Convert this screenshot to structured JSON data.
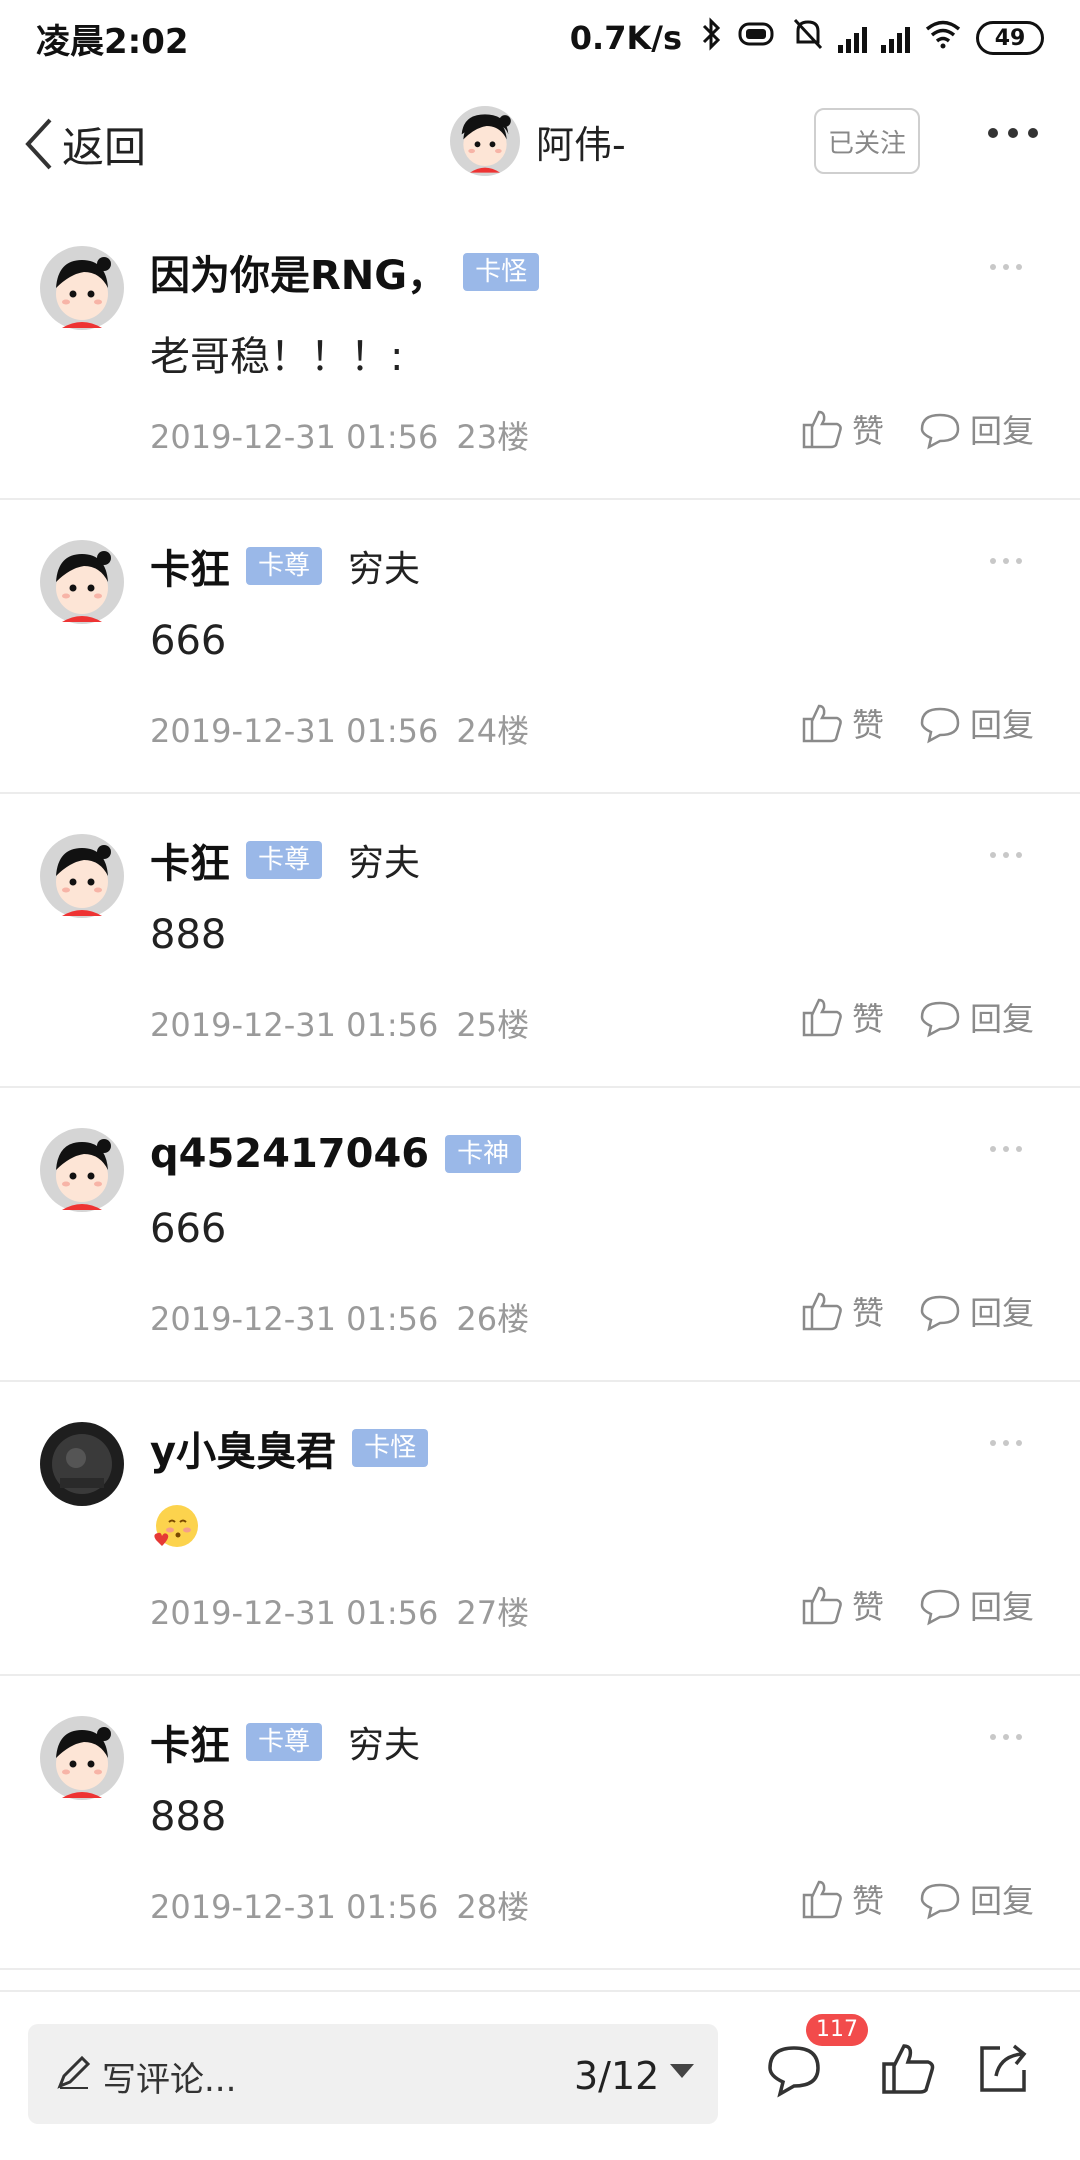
{
  "status_bar": {
    "time": "凌晨2:02",
    "net_speed": "0.7K/s",
    "battery": "49"
  },
  "header": {
    "back_label": "返回",
    "username": "阿伟-",
    "follow_label": "已关注"
  },
  "comments": [
    {
      "username": "因为你是RNG，",
      "badge": "卡怪",
      "title": "",
      "text": "老哥稳！！！:",
      "time": "2019-12-31 01:56",
      "floor": "23楼",
      "like": "赞",
      "reply": "回复"
    },
    {
      "username": "卡狂",
      "badge": "卡尊",
      "title": "穷夫",
      "text": "666",
      "time": "2019-12-31 01:56",
      "floor": "24楼",
      "like": "赞",
      "reply": "回复"
    },
    {
      "username": "卡狂",
      "badge": "卡尊",
      "title": "穷夫",
      "text": "888",
      "time": "2019-12-31 01:56",
      "floor": "25楼",
      "like": "赞",
      "reply": "回复"
    },
    {
      "username": "q452417046",
      "badge": "卡神",
      "title": "",
      "text": "666",
      "time": "2019-12-31 01:56",
      "floor": "26楼",
      "like": "赞",
      "reply": "回复"
    },
    {
      "username": "y小臭臭君",
      "badge": "卡怪",
      "title": "",
      "text": "",
      "emoji": "blush-love-emoji",
      "time": "2019-12-31 01:56",
      "floor": "27楼",
      "like": "赞",
      "reply": "回复"
    },
    {
      "username": "卡狂",
      "badge": "卡尊",
      "title": "穷夫",
      "text": "888",
      "time": "2019-12-31 01:56",
      "floor": "28楼",
      "like": "赞",
      "reply": "回复"
    }
  ],
  "bottom_bar": {
    "write_placeholder": "写评论...",
    "page_indicator": "3/12",
    "comment_count": "117"
  },
  "colors": {
    "badge": "#9ab8e8",
    "count_badge": "#f24b4b",
    "meta_text": "#9a9a9a",
    "divider": "#ececec"
  }
}
